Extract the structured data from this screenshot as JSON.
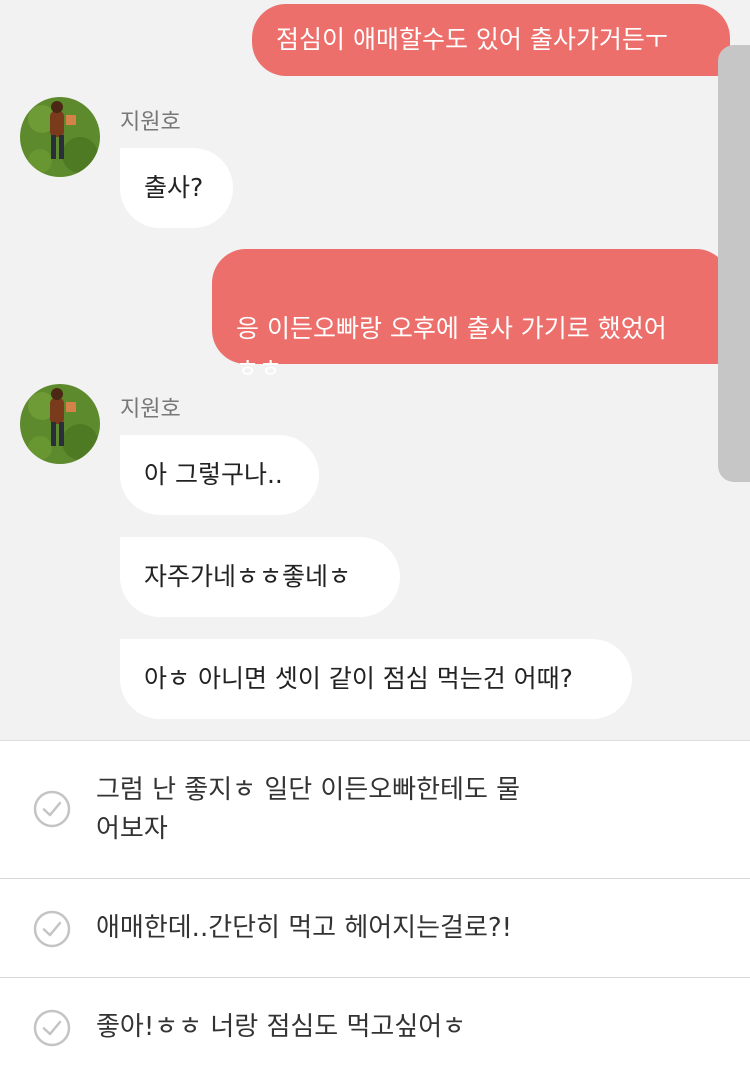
{
  "chat": {
    "messages": [
      {
        "from": "me",
        "text": "점심이 애매할수도 있어 출사가거든ㅜ"
      },
      {
        "from": "them",
        "sender": "지원호",
        "text": "출사?"
      },
      {
        "from": "me",
        "text": "응 이든오빠랑 오후에 출사 가기로 했었어\nㅎㅎ"
      },
      {
        "from": "them",
        "sender": "지원호",
        "text": "아 그렇구나.."
      },
      {
        "from": "them",
        "text": "자주가네ㅎㅎ좋네ㅎ"
      },
      {
        "from": "them",
        "text": "아ㅎ 아니면 셋이 같이 점심 먹는건 어때?"
      }
    ]
  },
  "options": [
    {
      "text": "그럼 난 좋지ㅎ 일단 이든오빠한테도 물\n어보자"
    },
    {
      "text": "애매한데..간단히 먹고 헤어지는걸로?!"
    },
    {
      "text": "좋아!ㅎㅎ 너랑 점심도 먹고싶어ㅎ"
    }
  ],
  "colors": {
    "my_bubble": "#ec6f6b",
    "their_bubble": "#ffffff",
    "chat_background": "#f2f2f2"
  },
  "icons": {
    "avatar": "grass-avatar-image",
    "option_check": "check-circle-icon"
  }
}
